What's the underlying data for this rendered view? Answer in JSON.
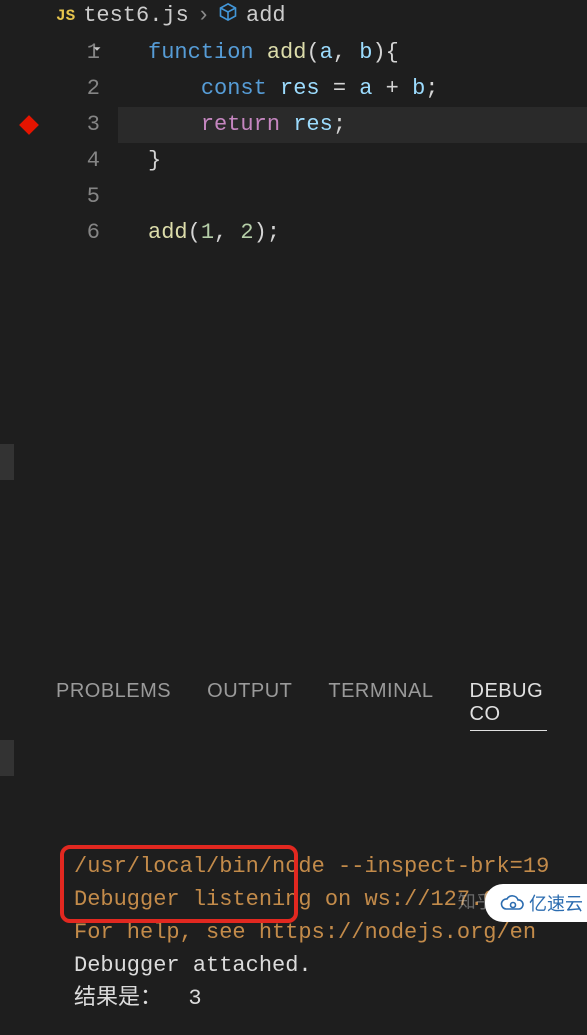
{
  "breadcrumb": {
    "file_type": "JS",
    "file_name": "test6.js",
    "separator": "›",
    "symbol": "add"
  },
  "code_lines": [
    {
      "n": 1,
      "tokens": [
        [
          "kw",
          "function "
        ],
        [
          "fn",
          "add"
        ],
        [
          "pn",
          "("
        ],
        [
          "id",
          "a"
        ],
        [
          "pn",
          ", "
        ],
        [
          "id",
          "b"
        ],
        [
          "pn",
          "){"
        ]
      ],
      "fold": true
    },
    {
      "n": 2,
      "tokens": [
        [
          "pn",
          "    "
        ],
        [
          "kw",
          "const "
        ],
        [
          "id",
          "res"
        ],
        [
          "pn",
          " = "
        ],
        [
          "id",
          "a"
        ],
        [
          "pn",
          " + "
        ],
        [
          "id",
          "b"
        ],
        [
          "pn",
          ";"
        ]
      ]
    },
    {
      "n": 3,
      "tokens": [
        [
          "pn",
          "    "
        ],
        [
          "kwret",
          "return "
        ],
        [
          "id",
          "res"
        ],
        [
          "pn",
          ";"
        ]
      ],
      "breakpoint": true,
      "hl": true
    },
    {
      "n": 4,
      "tokens": [
        [
          "pn",
          "}"
        ]
      ]
    },
    {
      "n": 5,
      "tokens": []
    },
    {
      "n": 6,
      "tokens": [
        [
          "fn",
          "add"
        ],
        [
          "pn",
          "("
        ],
        [
          "num",
          "1"
        ],
        [
          "pn",
          ", "
        ],
        [
          "num",
          "2"
        ],
        [
          "pn",
          ");"
        ]
      ]
    }
  ],
  "panel": {
    "tabs": [
      "PROBLEMS",
      "OUTPUT",
      "TERMINAL",
      "DEBUG CO"
    ],
    "active_index": 3
  },
  "console_lines": [
    {
      "cls": "",
      "text": "/usr/local/bin/node --inspect-brk=19"
    },
    {
      "cls": "",
      "text": "Debugger listening on ws://127.0.0.1"
    },
    {
      "cls": "",
      "text": "For help, see https://nodejs.org/en"
    },
    {
      "cls": "console-white",
      "text": "Debugger attached."
    },
    {
      "cls": "console-white",
      "text": "结果是：  3"
    }
  ],
  "watermark_zh": "知乎 @",
  "watermark_logo": "亿速云"
}
